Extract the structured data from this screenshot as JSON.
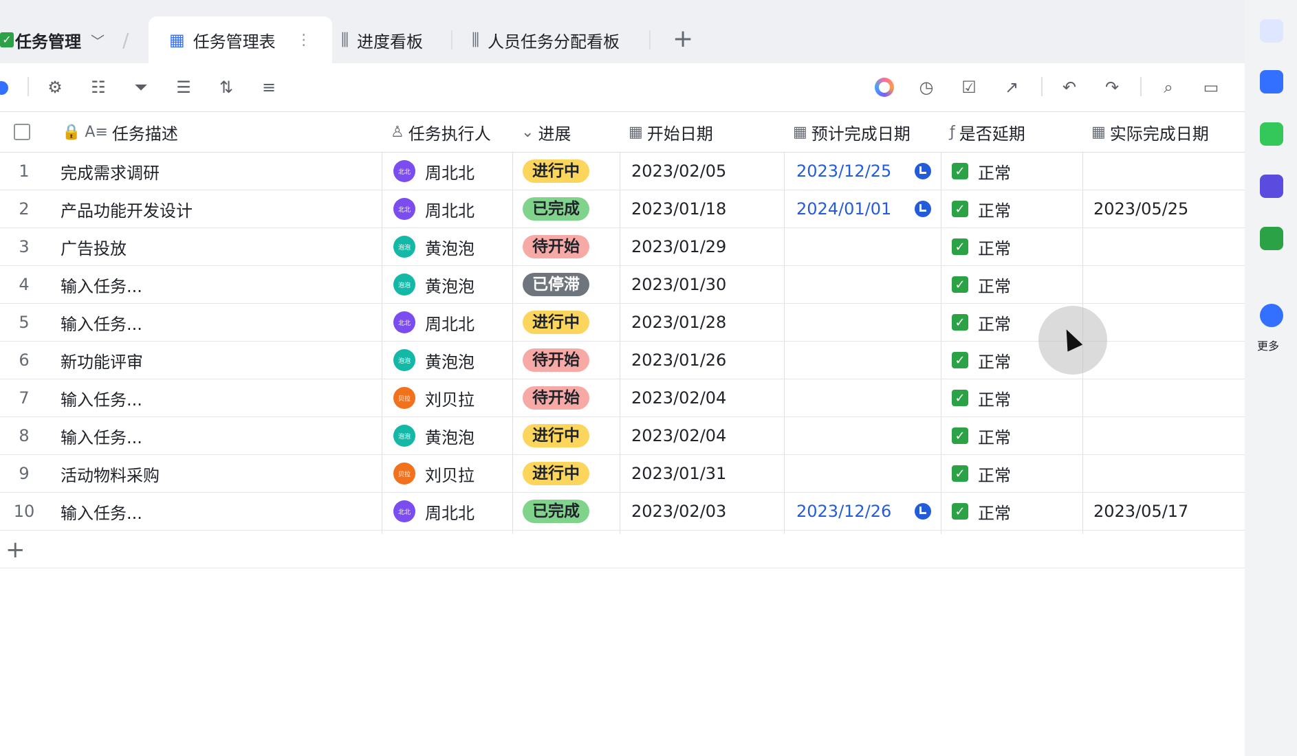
{
  "base": {
    "name": "任务管理"
  },
  "tabs": [
    {
      "label": "任务管理表",
      "active": true
    },
    {
      "label": "进度看板",
      "active": false
    },
    {
      "label": "人员任务分配看板",
      "active": false
    }
  ],
  "columns": [
    "任务描述",
    "任务执行人",
    "进展",
    "开始日期",
    "预计完成日期",
    "是否延期",
    "实际完成日期"
  ],
  "rows": [
    {
      "num": "1",
      "desc": "完成需求调研",
      "person": "周北北",
      "avatar": "北北",
      "status": "进行中",
      "start": "2023/02/05",
      "due": "2023/12/25",
      "delay": "正常",
      "done": ""
    },
    {
      "num": "2",
      "desc": "产品功能开发设计",
      "person": "周北北",
      "avatar": "北北",
      "status": "已完成",
      "start": "2023/01/18",
      "due": "2024/01/01",
      "delay": "正常",
      "done": "2023/05/25"
    },
    {
      "num": "3",
      "desc": "广告投放",
      "person": "黄泡泡",
      "avatar": "泡泡",
      "status": "待开始",
      "start": "2023/01/29",
      "due": "",
      "delay": "正常",
      "done": ""
    },
    {
      "num": "4",
      "desc": "输入任务...",
      "person": "黄泡泡",
      "avatar": "泡泡",
      "status": "已停滞",
      "start": "2023/01/30",
      "due": "",
      "delay": "正常",
      "done": ""
    },
    {
      "num": "5",
      "desc": "输入任务...",
      "person": "周北北",
      "avatar": "北北",
      "status": "进行中",
      "start": "2023/01/28",
      "due": "",
      "delay": "正常",
      "done": ""
    },
    {
      "num": "6",
      "desc": "新功能评审",
      "person": "黄泡泡",
      "avatar": "泡泡",
      "status": "待开始",
      "start": "2023/01/26",
      "due": "",
      "delay": "正常",
      "done": ""
    },
    {
      "num": "7",
      "desc": "输入任务...",
      "person": "刘贝拉",
      "avatar": "贝拉",
      "status": "待开始",
      "start": "2023/02/04",
      "due": "",
      "delay": "正常",
      "done": ""
    },
    {
      "num": "8",
      "desc": "输入任务...",
      "person": "黄泡泡",
      "avatar": "泡泡",
      "status": "进行中",
      "start": "2023/02/04",
      "due": "",
      "delay": "正常",
      "done": ""
    },
    {
      "num": "9",
      "desc": "活动物料采购",
      "person": "刘贝拉",
      "avatar": "贝拉",
      "status": "进行中",
      "start": "2023/01/31",
      "due": "",
      "delay": "正常",
      "done": ""
    },
    {
      "num": "10",
      "desc": "输入任务...",
      "person": "周北北",
      "avatar": "北北",
      "status": "已完成",
      "start": "2023/02/03",
      "due": "2023/12/26",
      "delay": "正常",
      "done": "2023/05/17"
    }
  ],
  "status_colors": {
    "进行中": {
      "bg": "#fcd65c",
      "fg": "#1f2329"
    },
    "已完成": {
      "bg": "#7fd38a",
      "fg": "#1f2329"
    },
    "待开始": {
      "bg": "#f7a9a5",
      "fg": "#1f2329"
    },
    "已停滞": {
      "bg": "#6f757d",
      "fg": "#ffffff"
    }
  },
  "avatar_colors": {
    "周北北": "#7b4cf0",
    "黄泡泡": "#14b8a6",
    "刘贝拉": "#f2711c"
  },
  "rail": {
    "more_label": "更多"
  }
}
